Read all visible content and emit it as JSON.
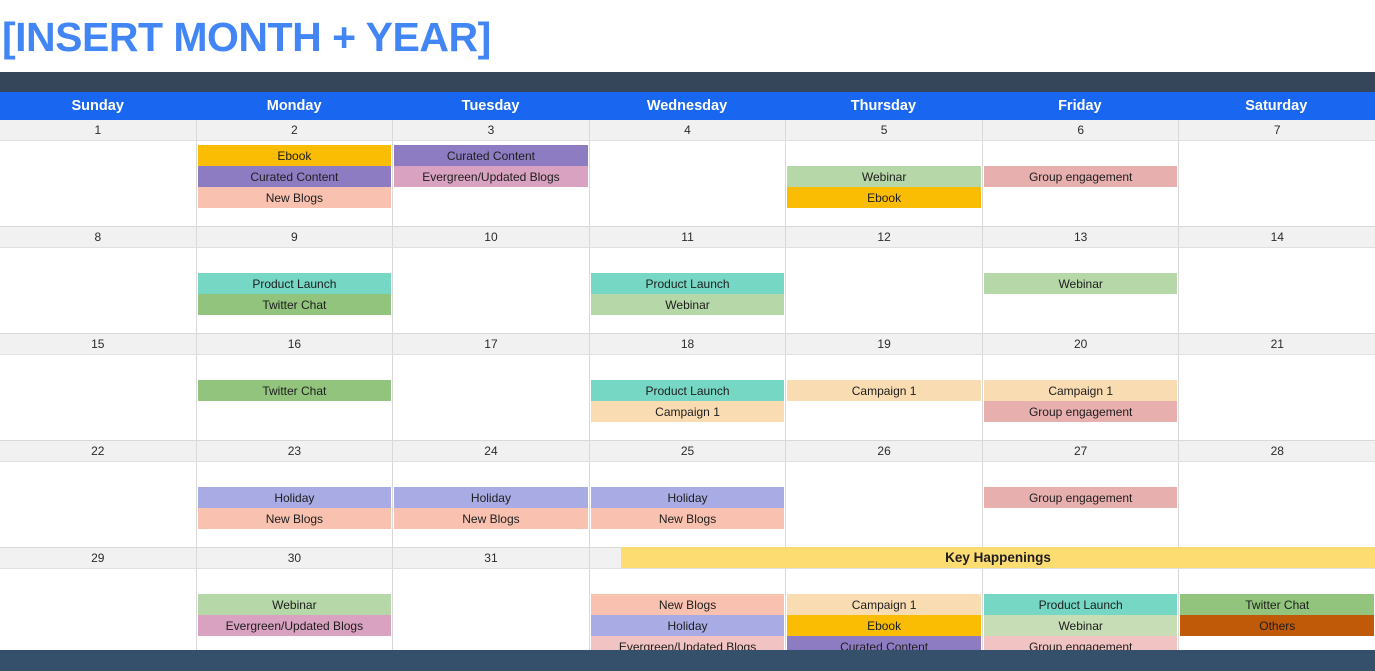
{
  "header": {
    "title": "[INSERT MONTH + YEAR]",
    "weekdays": [
      "Sunday",
      "Monday",
      "Tuesday",
      "Wednesday",
      "Thursday",
      "Friday",
      "Saturday"
    ]
  },
  "colors": {
    "title": "#4285F4",
    "weekday_header_bg": "#1967F0",
    "navy_strip": "#36465A",
    "bottom_bar": "#35506B",
    "date_row_bg": "#F1F1F1",
    "key_happenings_bg": "#FDDC72",
    "ebook": "#FBBC04",
    "curated_content": "#8E7CC3",
    "new_blogs": "#F9C2B0",
    "evergreen_updated_blogs": "#D9A2C0",
    "webinar": "#B6D7A8",
    "webinar_light": "#C7DDB6",
    "group_engagement": "#E8AFAF",
    "group_engagement_light": "#F2C3C3",
    "product_launch": "#76D7C4",
    "twitter_chat": "#93C47D",
    "campaign_1": "#FADCB3",
    "holiday": "#A9ACE4",
    "others": "#C05A08"
  },
  "legend_types": [
    {
      "name": "Ebook",
      "color": "#FBBC04"
    },
    {
      "name": "Curated Content",
      "color": "#8E7CC3"
    },
    {
      "name": "New Blogs",
      "color": "#F9C2B0"
    },
    {
      "name": "Evergreen/Updated Blogs",
      "color": "#D9A2C0"
    },
    {
      "name": "Webinar",
      "color": "#B6D7A8"
    },
    {
      "name": "Group engagement",
      "color": "#E8AFAF"
    },
    {
      "name": "Product Launch",
      "color": "#76D7C4"
    },
    {
      "name": "Twitter Chat",
      "color": "#93C47D"
    },
    {
      "name": "Campaign 1",
      "color": "#FADCB3"
    },
    {
      "name": "Holiday",
      "color": "#A9ACE4"
    },
    {
      "name": "Others",
      "color": "#C05A08"
    }
  ],
  "weeks": [
    {
      "days": [
        {
          "date": "1",
          "offset": 0,
          "events": []
        },
        {
          "date": "2",
          "offset": 0,
          "events": [
            {
              "label": "Ebook",
              "color": "#FBBC04"
            },
            {
              "label": "Curated Content",
              "color": "#8E7CC3"
            },
            {
              "label": "New Blogs",
              "color": "#F9C2B0"
            }
          ]
        },
        {
          "date": "3",
          "offset": 0,
          "events": [
            {
              "label": "Curated Content",
              "color": "#8E7CC3"
            },
            {
              "label": "Evergreen/Updated Blogs",
              "color": "#D9A2C0"
            }
          ]
        },
        {
          "date": "4",
          "offset": 0,
          "events": []
        },
        {
          "date": "5",
          "offset": 1,
          "events": [
            {
              "label": "Webinar",
              "color": "#B6D7A8"
            },
            {
              "label": "Ebook",
              "color": "#FBBC04"
            }
          ]
        },
        {
          "date": "6",
          "offset": 1,
          "events": [
            {
              "label": "Group engagement",
              "color": "#E8AFAF"
            }
          ]
        },
        {
          "date": "7",
          "offset": 0,
          "events": []
        }
      ]
    },
    {
      "days": [
        {
          "date": "8",
          "offset": 0,
          "events": []
        },
        {
          "date": "9",
          "offset": 1,
          "events": [
            {
              "label": "Product Launch",
              "color": "#76D7C4"
            },
            {
              "label": "Twitter Chat",
              "color": "#93C47D"
            }
          ]
        },
        {
          "date": "10",
          "offset": 0,
          "events": []
        },
        {
          "date": "11",
          "offset": 1,
          "events": [
            {
              "label": "Product Launch",
              "color": "#76D7C4"
            },
            {
              "label": "Webinar",
              "color": "#B6D7A8"
            }
          ]
        },
        {
          "date": "12",
          "offset": 0,
          "events": []
        },
        {
          "date": "13",
          "offset": 1,
          "events": [
            {
              "label": "Webinar",
              "color": "#B6D7A8"
            }
          ]
        },
        {
          "date": "14",
          "offset": 0,
          "events": []
        }
      ]
    },
    {
      "days": [
        {
          "date": "15",
          "offset": 0,
          "events": []
        },
        {
          "date": "16",
          "offset": 1,
          "events": [
            {
              "label": "Twitter Chat",
              "color": "#93C47D"
            }
          ]
        },
        {
          "date": "17",
          "offset": 0,
          "events": []
        },
        {
          "date": "18",
          "offset": 1,
          "events": [
            {
              "label": "Product Launch",
              "color": "#76D7C4"
            },
            {
              "label": "Campaign 1",
              "color": "#FADCB3"
            }
          ]
        },
        {
          "date": "19",
          "offset": 1,
          "events": [
            {
              "label": "Campaign 1",
              "color": "#FADCB3"
            }
          ]
        },
        {
          "date": "20",
          "offset": 1,
          "events": [
            {
              "label": "Campaign 1",
              "color": "#FADCB3"
            },
            {
              "label": "Group engagement",
              "color": "#E8AFAF"
            }
          ]
        },
        {
          "date": "21",
          "offset": 0,
          "events": []
        }
      ]
    },
    {
      "days": [
        {
          "date": "22",
          "offset": 0,
          "events": []
        },
        {
          "date": "23",
          "offset": 1,
          "events": [
            {
              "label": "Holiday",
              "color": "#A9ACE4"
            },
            {
              "label": "New Blogs",
              "color": "#F9C2B0"
            }
          ]
        },
        {
          "date": "24",
          "offset": 1,
          "events": [
            {
              "label": "Holiday",
              "color": "#A9ACE4"
            },
            {
              "label": "New Blogs",
              "color": "#F9C2B0"
            }
          ]
        },
        {
          "date": "25",
          "offset": 1,
          "events": [
            {
              "label": "Holiday",
              "color": "#A9ACE4"
            },
            {
              "label": "New Blogs",
              "color": "#F9C2B0"
            }
          ]
        },
        {
          "date": "26",
          "offset": 0,
          "events": []
        },
        {
          "date": "27",
          "offset": 1,
          "events": [
            {
              "label": "Group engagement",
              "color": "#E8AFAF"
            }
          ]
        },
        {
          "date": "28",
          "offset": 0,
          "events": []
        }
      ]
    },
    {
      "days": [
        {
          "date": "29",
          "offset": 0,
          "events": []
        },
        {
          "date": "30",
          "offset": 1,
          "events": [
            {
              "label": "Webinar",
              "color": "#B6D7A8"
            },
            {
              "label": "Evergreen/Updated Blogs",
              "color": "#D9A2C0"
            }
          ]
        },
        {
          "date": "31",
          "offset": 0,
          "events": []
        },
        {
          "date": "",
          "offset": 1,
          "events": [
            {
              "label": "New Blogs",
              "color": "#F9C2B0"
            },
            {
              "label": "Holiday",
              "color": "#A9ACE4"
            },
            {
              "label": "Evergreen/Updated Blogs",
              "color": "#F2C3C3"
            }
          ]
        },
        {
          "date": "",
          "offset": 1,
          "events": [
            {
              "label": "Campaign 1",
              "color": "#FADCB3"
            },
            {
              "label": "Ebook",
              "color": "#FBBC04"
            },
            {
              "label": "Curated Content",
              "color": "#8E7CC3"
            }
          ]
        },
        {
          "date": "",
          "offset": 1,
          "events": [
            {
              "label": "Product Launch",
              "color": "#76D7C4"
            },
            {
              "label": "Webinar",
              "color": "#C7DDB6"
            },
            {
              "label": "Group engagement",
              "color": "#F2C3C3"
            }
          ]
        },
        {
          "date": "",
          "offset": 1,
          "events": [
            {
              "label": "Twitter Chat",
              "color": "#93C47D"
            },
            {
              "label": "Others",
              "color": "#C05A08"
            }
          ]
        }
      ]
    }
  ],
  "key_happenings": {
    "title": "Key Happenings"
  }
}
